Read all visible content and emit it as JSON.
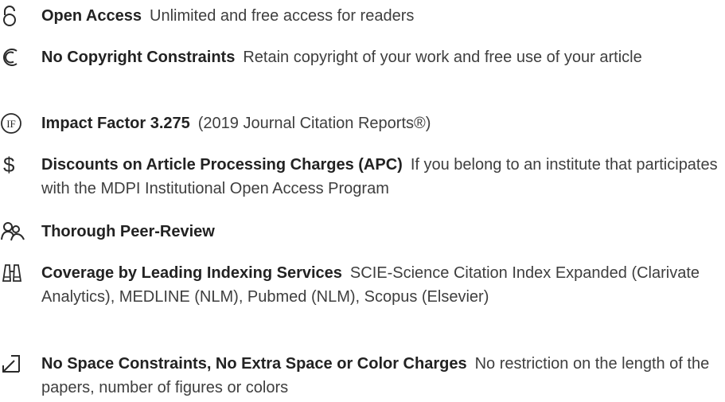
{
  "features": [
    {
      "icon": "open-lock-icon",
      "title": "Open Access",
      "description": "Unlimited and free access for readers"
    },
    {
      "icon": "copyright-icon",
      "title": "No Copyright Constraints",
      "description": "Retain copyright of your work and free use of your article"
    },
    {
      "icon": "impact-factor-icon",
      "icon_text": "IF",
      "title": "Impact Factor 3.275",
      "description": "(2019 Journal Citation Reports®)"
    },
    {
      "icon": "dollar-icon",
      "icon_text": "$",
      "title": "Discounts on Article Processing Charges (APC)",
      "description": "If you belong to an institute that participates with the MDPI Institutional Open Access Program"
    },
    {
      "icon": "peer-review-icon",
      "title": "Thorough Peer-Review",
      "description": ""
    },
    {
      "icon": "binoculars-icon",
      "title": "Coverage by Leading Indexing Services",
      "description": "SCIE-Science Citation Index Expanded (Clarivate Analytics), MEDLINE (NLM), Pubmed (NLM), Scopus (Elsevier)"
    },
    {
      "icon": "expand-icon",
      "title": "No Space Constraints, No Extra Space or Color Charges",
      "description": "No restriction on the length of the papers, number of figures or colors"
    }
  ],
  "colors": {
    "text": "#3a3a3a",
    "title": "#222222",
    "icon": "#2a2a2a"
  }
}
